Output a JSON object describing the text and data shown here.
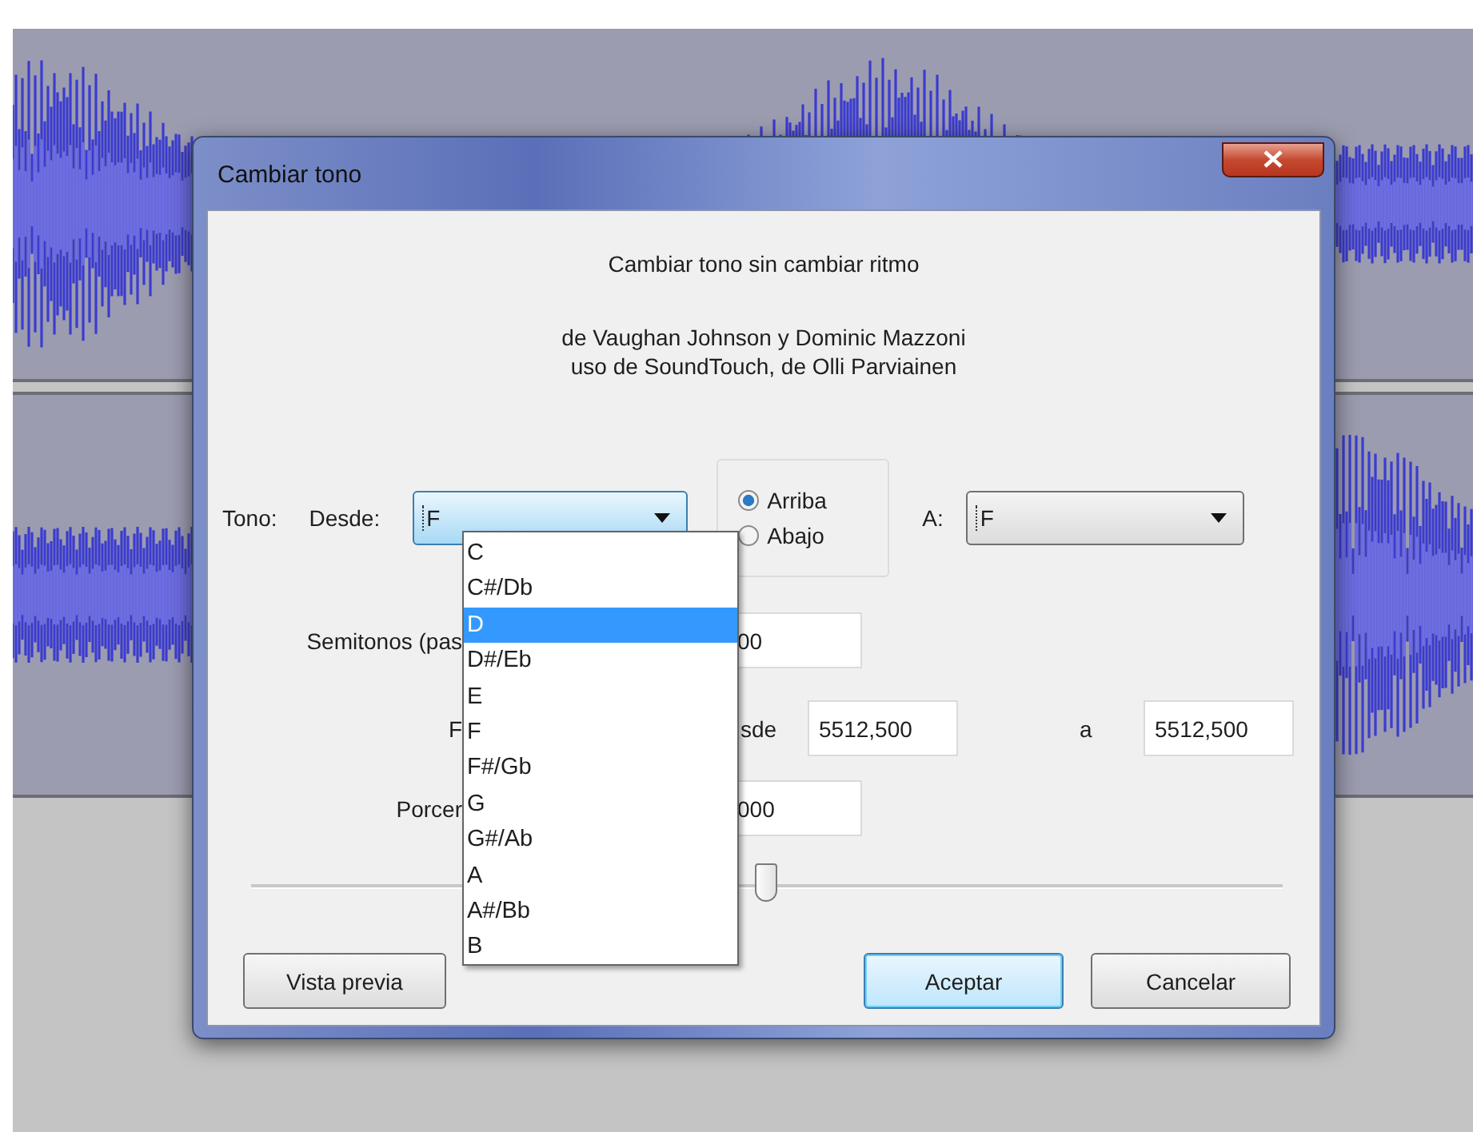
{
  "window": {
    "title": "Cambiar tono"
  },
  "heading": "Cambiar tono sin cambiar ritmo",
  "credits": [
    "de Vaughan Johnson y Dominic Mazzoni",
    "uso de SoundTouch, de Olli Parviainen"
  ],
  "pitch": {
    "label": "Tono:",
    "from_label": "Desde:",
    "from_value": "F",
    "to_label": "A:",
    "to_value": "F",
    "direction": [
      {
        "label": "Arriba",
        "selected": true
      },
      {
        "label": "Abajo",
        "selected": false
      }
    ]
  },
  "dropdown": {
    "items": [
      {
        "label": "C",
        "selected": false
      },
      {
        "label": "C#/Db",
        "selected": false
      },
      {
        "label": "D",
        "selected": true
      },
      {
        "label": "D#/Eb",
        "selected": false
      },
      {
        "label": "E",
        "selected": false
      },
      {
        "label": "F",
        "selected": false
      },
      {
        "label": "F#/Gb",
        "selected": false
      },
      {
        "label": "G",
        "selected": false
      },
      {
        "label": "G#/Ab",
        "selected": false
      },
      {
        "label": "A",
        "selected": false
      },
      {
        "label": "A#/Bb",
        "selected": false
      },
      {
        "label": "B",
        "selected": false
      }
    ]
  },
  "semitones": {
    "label": "Semitonos (pas",
    "value": "00"
  },
  "frequency": {
    "label": "F",
    "from_label": "sde",
    "from_value": "5512,500",
    "to_label": "a",
    "to_value": "5512,500"
  },
  "percent": {
    "label": "Porcer",
    "value": "000"
  },
  "slider": {
    "level": 0.5
  },
  "buttons": [
    {
      "label": "Vista previa",
      "default": false
    },
    {
      "label": "Aceptar",
      "default": true
    },
    {
      "label": "Cancelar",
      "default": false
    }
  ]
}
